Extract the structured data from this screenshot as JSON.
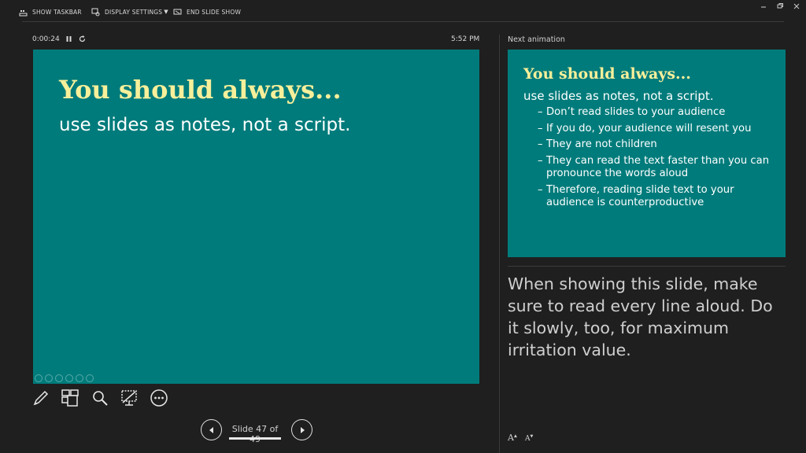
{
  "toolbar": {
    "show_taskbar": "SHOW TASKBAR",
    "display_settings": "DISPLAY SETTINGS",
    "end_slide_show": "END SLIDE SHOW"
  },
  "presenter": {
    "timer": "0:00:24",
    "clock": "5:52 PM"
  },
  "current_slide": {
    "title": "You should always...",
    "subtitle": "use slides as notes, not a script.",
    "background": "#007b7b",
    "title_color": "#f7ef9a"
  },
  "tools": [
    "pen-icon",
    "see-all-slides-icon",
    "zoom-icon",
    "black-screen-icon",
    "more-options-icon"
  ],
  "navigation": {
    "slide_counter": "Slide 47 of 49"
  },
  "next": {
    "label": "Next animation",
    "title": "You should always...",
    "subtitle": "use slides as notes, not a script.",
    "bullets": [
      "Don’t read slides to your audience",
      "If you do, your audience will resent you",
      "They are not children",
      "They can read the text faster than you can pronounce the words aloud",
      "Therefore, reading slide text to your audience is counterproductive"
    ]
  },
  "notes": {
    "text": "When showing this slide, make sure to read every line aloud. Do it slowly, too, for maximum irritation value."
  },
  "font_controls": {
    "increase": "A",
    "decrease": "A"
  }
}
